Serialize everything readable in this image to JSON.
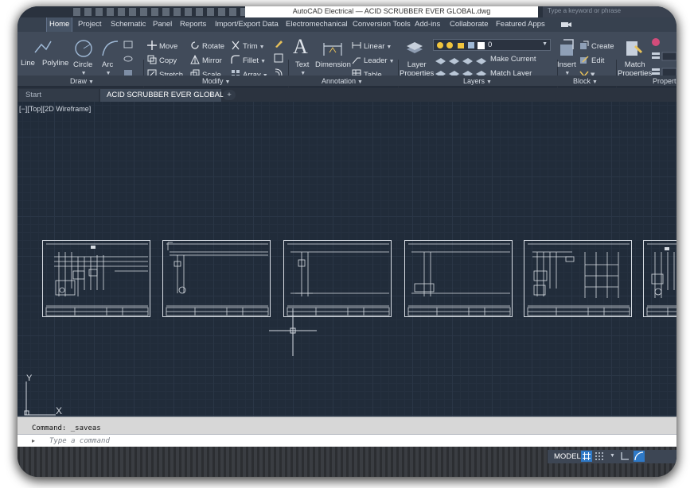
{
  "window": {
    "title": "AutoCAD Electrical — ACID SCRUBBER EVER GLOBAL.dwg",
    "search_placeholder": "Type a keyword or phrase"
  },
  "menu_tabs": [
    {
      "label": "Home",
      "active": true
    },
    {
      "label": "Project"
    },
    {
      "label": "Schematic"
    },
    {
      "label": "Panel"
    },
    {
      "label": "Reports"
    },
    {
      "label": "Import/Export Data"
    },
    {
      "label": "Electromechanical"
    },
    {
      "label": "Conversion Tools"
    },
    {
      "label": "Add-ins"
    },
    {
      "label": "Collaborate"
    },
    {
      "label": "Featured Apps"
    }
  ],
  "ribbon": {
    "draw": {
      "label": "Draw",
      "line": "Line",
      "polyline": "Polyline",
      "circle": "Circle",
      "arc": "Arc"
    },
    "modify": {
      "label": "Modify",
      "move": "Move",
      "rotate": "Rotate",
      "trim": "Trim",
      "copy": "Copy",
      "mirror": "Mirror",
      "fillet": "Fillet",
      "stretch": "Stretch",
      "scale": "Scale",
      "array": "Array"
    },
    "annotation": {
      "label": "Annotation",
      "text": "Text",
      "dimension": "Dimension",
      "linear": "Linear",
      "leader": "Leader",
      "table": "Table"
    },
    "layers": {
      "label": "Layers",
      "layer_properties_1": "Layer",
      "layer_properties_2": "Properties",
      "current_layer": "0",
      "make_current": "Make Current",
      "match_layer": "Match Layer"
    },
    "block": {
      "label": "Block",
      "insert": "Insert",
      "create": "Create",
      "edit": "Edit"
    },
    "properties": {
      "label": "Properties",
      "match_properties_1": "Match",
      "match_properties_2": "Properties"
    }
  },
  "doc_tabs": {
    "start": "Start",
    "document": "ACID SCRUBBER EVER GLOBAL*",
    "close": "×",
    "add": "+"
  },
  "viewport": {
    "label": "[−][Top][2D Wireframe]",
    "ucs_x": "X",
    "ucs_y": "Y"
  },
  "command": {
    "history": "Command: _saveas",
    "placeholder": "Type a command"
  },
  "status": {
    "model": "MODEL"
  },
  "colors": {
    "canvas": "#212c3a",
    "ribbon": "#414b5a",
    "accent": "#2e79c7"
  }
}
